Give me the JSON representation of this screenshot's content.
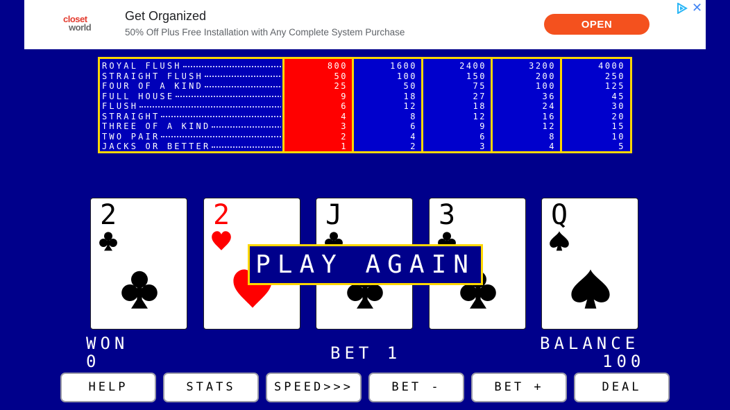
{
  "ad": {
    "logo_line1": "closet",
    "logo_line2": "world",
    "title": "Get Organized",
    "subtitle": "50% Off Plus Free Installation with Any Complete System Purchase",
    "cta": "OPEN",
    "close": "✕"
  },
  "paytable": {
    "hands": [
      "ROYAL FLUSH",
      "STRAIGHT FLUSH",
      "FOUR OF A KIND",
      "FULL HOUSE",
      "FLUSH",
      "STRAIGHT",
      "THREE OF A KIND",
      "TWO PAIR",
      "JACKS OR BETTER"
    ],
    "columns": [
      [
        "800",
        "50",
        "25",
        "9",
        "6",
        "4",
        "3",
        "2",
        "1"
      ],
      [
        "1600",
        "100",
        "50",
        "18",
        "12",
        "8",
        "6",
        "4",
        "2"
      ],
      [
        "2400",
        "150",
        "75",
        "27",
        "18",
        "12",
        "9",
        "6",
        "3"
      ],
      [
        "3200",
        "200",
        "100",
        "36",
        "24",
        "16",
        "12",
        "8",
        "4"
      ],
      [
        "4000",
        "250",
        "125",
        "45",
        "30",
        "20",
        "15",
        "10",
        "5"
      ]
    ],
    "selected_column": 1,
    "colors": {
      "border": "#ffd700",
      "selected": "#ff0000",
      "background": "#0000cc"
    }
  },
  "cards": [
    {
      "rank": "2",
      "suit": "clubs",
      "color": "black"
    },
    {
      "rank": "2",
      "suit": "hearts",
      "color": "red"
    },
    {
      "rank": "J",
      "suit": "clubs",
      "color": "black"
    },
    {
      "rank": "3",
      "suit": "clubs",
      "color": "black"
    },
    {
      "rank": "Q",
      "suit": "spades",
      "color": "black"
    }
  ],
  "banner": {
    "label": "PLAY AGAIN"
  },
  "status": {
    "won_label": "WON",
    "won_value": "0",
    "bet_text": "BET 1",
    "balance_label": "BALANCE",
    "balance_value": "100"
  },
  "buttons": {
    "help": "HELP",
    "stats": "STATS",
    "speed": "SPEED>>>",
    "bet_minus": "BET -",
    "bet_plus": "BET +",
    "deal": "DEAL"
  },
  "colors": {
    "background": "#00008b",
    "accent": "#ffd700",
    "ad_cta": "#f4511e"
  }
}
